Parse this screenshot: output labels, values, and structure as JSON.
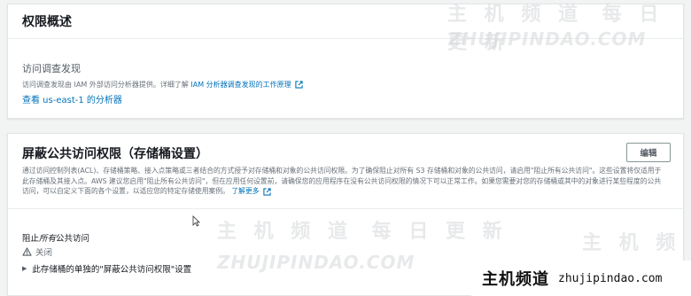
{
  "access_panel": {
    "title": "权限概述",
    "findings_label": "访问调查发现",
    "findings_desc": "访问调查发现由 IAM 外部访问分析器提供。详细了解",
    "findings_link": "IAM 分析器调查发现的工作原理",
    "analyzer_link": "查看 us-east-1 的分析器"
  },
  "block_panel": {
    "title": "屏蔽公共访问权限（存储桶设置）",
    "edit_label": "编辑",
    "description": "通过访问控制列表(ACL)、存储桶策略、接入点策略或三者结合的方式授予对存储桶和对象的公共访问权限。为了确保阻止对所有 S3 存储桶和对象的公共访问，请启用\"阻止所有公共访问\"。这些设置将仅适用于此存储桶及其接入点。AWS 建议您启用\"阻止所有公共访问\"，但在应用任何设置前，请确保您的应用程序在没有公共访问权限的情况下可以正常工作。如果您需要对您的存储桶或其中的对象进行某些程度的公共访问，可以自定义下面的各个设置，以适应您的特定存储使用案例。",
    "learn_more": "了解更多",
    "block_all_prefix": "阻止",
    "block_all_emph": "所有",
    "block_all_suffix": "公共访问",
    "status": "关闭",
    "expander_label": "此存储桶的单独的\"屏蔽公共访问权限\"设置"
  },
  "watermarks": {
    "cn": "主 机 频 道",
    "cn2": "每 日 更 新",
    "url": "ZHUJIPINDAO.COM"
  },
  "badge": {
    "title": "主机频道",
    "url": "zhujipindao.com"
  },
  "colors": {
    "link": "#0073bb",
    "warning": "#545b64",
    "border": "#879596"
  }
}
